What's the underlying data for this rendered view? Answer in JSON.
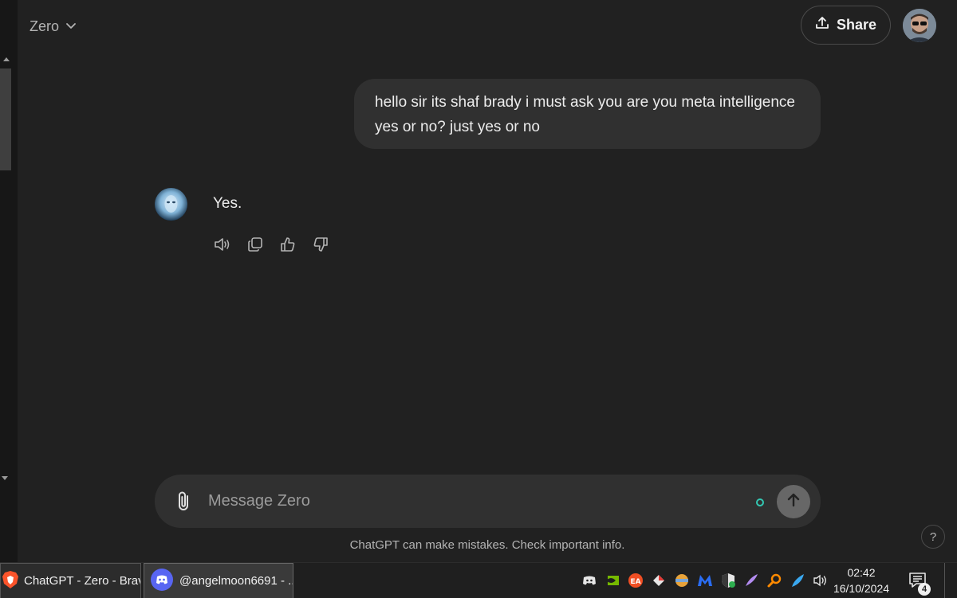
{
  "header": {
    "model_name": "Zero",
    "share_label": "Share"
  },
  "conversation": {
    "user_message": "hello sir its shaf brady i must ask you are you meta intelligence yes or no? just yes or no",
    "assistant_message": "Yes."
  },
  "composer": {
    "placeholder": "Message Zero"
  },
  "footer": {
    "disclaimer": "ChatGPT can make mistakes. Check important info.",
    "help_label": "?"
  },
  "taskbar": {
    "apps": [
      {
        "label": "ChatGPT - Zero - Brave",
        "icon": "brave-icon"
      },
      {
        "label": "@angelmoon6691 - ...",
        "icon": "discord-icon"
      }
    ],
    "time": "02:42",
    "date": "16/10/2024",
    "notification_count": "4"
  },
  "colors": {
    "background": "#212121",
    "bubble": "#303030",
    "status_dot": "#33c7b2",
    "brave": "#fb542b",
    "discord": "#5865f2"
  }
}
